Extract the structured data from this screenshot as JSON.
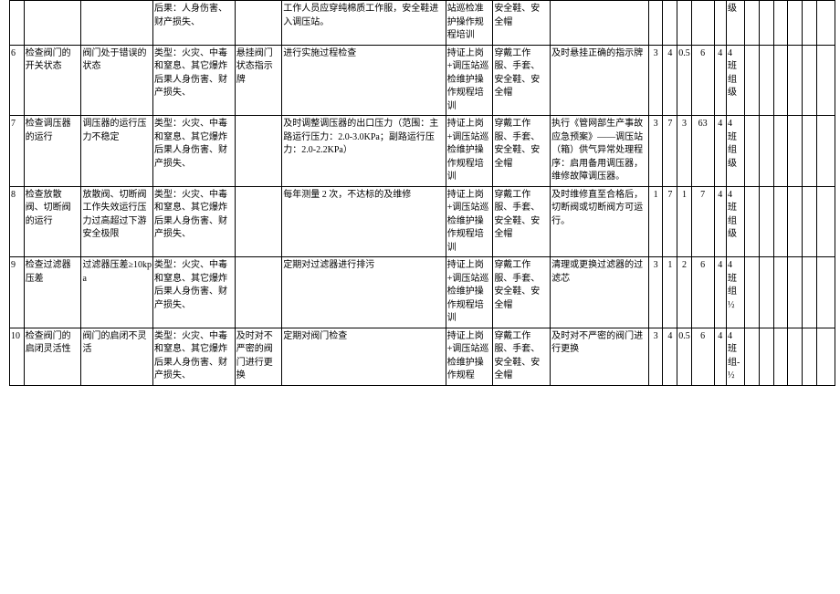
{
  "rows": [
    {
      "idx": "",
      "act": "",
      "dev": "",
      "type": "后果：人身伤害、财产损失、",
      "ind": "",
      "meas": "工作人员应穿纯棉质工作服，安全鞋进入调压站。",
      "train": "站巡检准护操作规程培训",
      "ppe": "安全鞋、安全帽",
      "emg": "",
      "n1": "",
      "n2": "",
      "n3": "",
      "n4": "",
      "n5": "",
      "lvl": "级",
      "e1": "",
      "e2": "",
      "e3": "",
      "e4": "",
      "e5": "",
      "e6": ""
    },
    {
      "idx": "6",
      "act": "检查阀门的开关状态",
      "dev": "阀门处于错误的状态",
      "type": "类型：火灾、中毒和窒息、其它爆炸后果人身伤害、财产损失、",
      "ind": "悬挂阀门状态指示牌",
      "meas": "进行实施过程检查",
      "train": "持证上岗+调压站巡检维护操作规程培训",
      "ppe": "穿戴工作服、手套、安全鞋、安全帽",
      "emg": "及时悬挂正确的指示牌",
      "n1": "3",
      "n2": "4",
      "n3": "0.5",
      "n4": "6",
      "n5": "4",
      "lvl": "4 班组级",
      "e1": "",
      "e2": "",
      "e3": "",
      "e4": "",
      "e5": "",
      "e6": ""
    },
    {
      "idx": "7",
      "act": "检查调压器的运行",
      "dev": "调压器的运行压力不稳定",
      "type": "类型：火灾、中毒和窒息、其它爆炸后果人身伤害、财产损失、",
      "ind": "",
      "meas": "及时调整调压器的出口压力（范围：主路运行压力：2.0-3.0KPa；副路运行压力：2.0-2.2KPa）",
      "train": "持证上岗+调压站巡检维护操作规程培训",
      "ppe": "穿戴工作服、手套、安全鞋、安全帽",
      "emg": "执行《管网部生产事故应急预案》——调压站（箱）供气异常处理程序：启用备用调压器，维修故障调压器。",
      "n1": "3",
      "n2": "7",
      "n3": "3",
      "n4": "63",
      "n5": "4",
      "lvl": "4 班组级",
      "e1": "",
      "e2": "",
      "e3": "",
      "e4": "",
      "e5": "",
      "e6": ""
    },
    {
      "idx": "8",
      "act": "检查放散阀、切断阀的运行",
      "dev": "放散阀、切断阀工作失效运行压力过高超过下游安全极限",
      "type": "类型：火灾、中毒和窒息、其它爆炸后果人身伤害、财产损失、",
      "ind": "",
      "meas": "每年测量 2 次，不达标的及维修",
      "train": "持证上岗+调压站巡检维护操作规程培训",
      "ppe": "穿戴工作服、手套、安全鞋、安全帽",
      "emg": "及时维修直至合格后，切断阀或切断阀方可运行。",
      "n1": "1",
      "n2": "7",
      "n3": "1",
      "n4": "7",
      "n5": "4",
      "lvl": "4 班组级",
      "e1": "",
      "e2": "",
      "e3": "",
      "e4": "",
      "e5": "",
      "e6": ""
    },
    {
      "idx": "9",
      "act": "检查过滤器压差",
      "dev": "过滤器压差≥10kpa",
      "type": "类型：火灾、中毒和窒息、其它爆炸后果人身伤害、财产损失、",
      "ind": "",
      "meas": "定期对过滤器进行排污",
      "train": "持证上岗+调压站巡检维护操作规程培训",
      "ppe": "穿戴工作服、手套、安全鞋、安全帽",
      "emg": "清理或更换过滤器的过滤芯",
      "n1": "3",
      "n2": "1",
      "n3": "2",
      "n4": "6",
      "n5": "4",
      "lvl": "4 班组½",
      "e1": "",
      "e2": "",
      "e3": "",
      "e4": "",
      "e5": "",
      "e6": ""
    },
    {
      "idx": "10",
      "act": "检查阀门的启闭灵活性",
      "dev": "阀门的启闭不灵活",
      "type": "类型：火灾、中毒和窒息、其它爆炸后果人身伤害、财产损失、",
      "ind": "及时对不严密的阀门进行更换",
      "meas": "定期对阀门检查",
      "train": "持证上岗+调压站巡检维护操作规程",
      "ppe": "穿戴工作服、手套、安全鞋、安全帽",
      "emg": "及时对不严密的阀门进行更换",
      "n1": "3",
      "n2": "4",
      "n3": "0.5",
      "n4": "6",
      "n5": "4",
      "lvl": "4 班组-½",
      "e1": "",
      "e2": "",
      "e3": "",
      "e4": "",
      "e5": "",
      "e6": ""
    }
  ]
}
